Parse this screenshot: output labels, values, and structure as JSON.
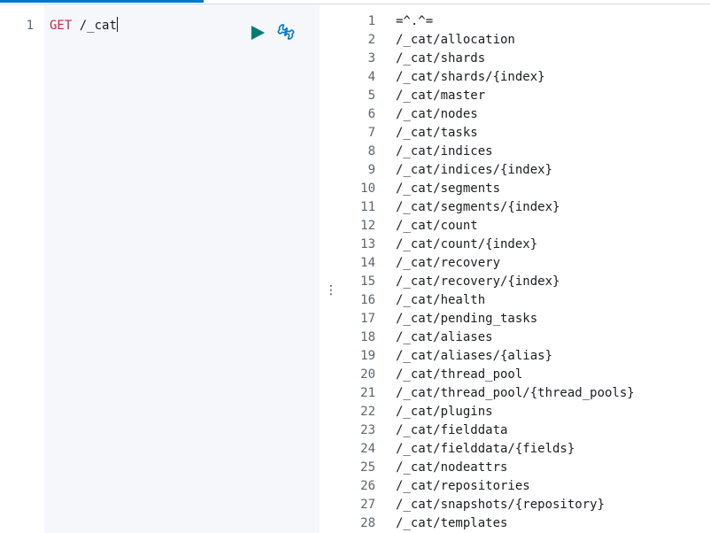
{
  "request": {
    "line_number": "1",
    "method": "GET",
    "path": "/_cat"
  },
  "icons": {
    "run": "play-icon",
    "settings": "wrench-icon",
    "resize": "vertical-dots-icon"
  },
  "colors": {
    "method": "#c4274a",
    "play": "#017d73",
    "wrench": "#0077cc",
    "tab_underline": "#0077cc"
  },
  "response": {
    "lines": [
      {
        "num": "1",
        "text": "=^.^="
      },
      {
        "num": "2",
        "text": "/_cat/allocation"
      },
      {
        "num": "3",
        "text": "/_cat/shards"
      },
      {
        "num": "4",
        "text": "/_cat/shards/{index}"
      },
      {
        "num": "5",
        "text": "/_cat/master"
      },
      {
        "num": "6",
        "text": "/_cat/nodes"
      },
      {
        "num": "7",
        "text": "/_cat/tasks"
      },
      {
        "num": "8",
        "text": "/_cat/indices"
      },
      {
        "num": "9",
        "text": "/_cat/indices/{index}"
      },
      {
        "num": "10",
        "text": "/_cat/segments"
      },
      {
        "num": "11",
        "text": "/_cat/segments/{index}"
      },
      {
        "num": "12",
        "text": "/_cat/count"
      },
      {
        "num": "13",
        "text": "/_cat/count/{index}"
      },
      {
        "num": "14",
        "text": "/_cat/recovery"
      },
      {
        "num": "15",
        "text": "/_cat/recovery/{index}"
      },
      {
        "num": "16",
        "text": "/_cat/health"
      },
      {
        "num": "17",
        "text": "/_cat/pending_tasks"
      },
      {
        "num": "18",
        "text": "/_cat/aliases"
      },
      {
        "num": "19",
        "text": "/_cat/aliases/{alias}"
      },
      {
        "num": "20",
        "text": "/_cat/thread_pool"
      },
      {
        "num": "21",
        "text": "/_cat/thread_pool/{thread_pools}"
      },
      {
        "num": "22",
        "text": "/_cat/plugins"
      },
      {
        "num": "23",
        "text": "/_cat/fielddata"
      },
      {
        "num": "24",
        "text": "/_cat/fielddata/{fields}"
      },
      {
        "num": "25",
        "text": "/_cat/nodeattrs"
      },
      {
        "num": "26",
        "text": "/_cat/repositories"
      },
      {
        "num": "27",
        "text": "/_cat/snapshots/{repository}"
      },
      {
        "num": "28",
        "text": "/_cat/templates"
      }
    ]
  }
}
